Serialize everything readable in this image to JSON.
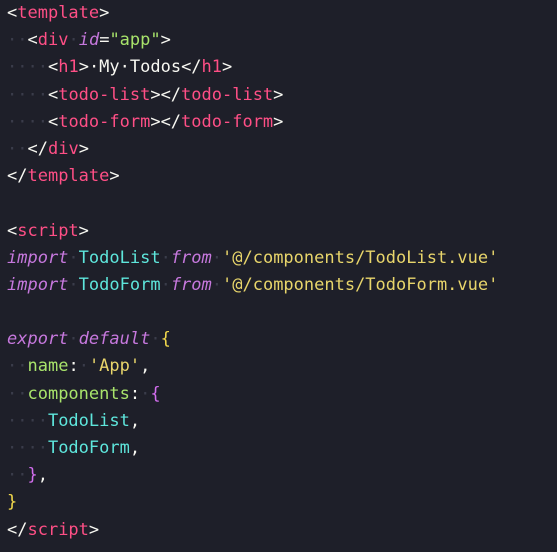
{
  "editor": {
    "lines": [
      [
        {
          "t": "<",
          "c": "t-punct"
        },
        {
          "t": "template",
          "c": "t-tag"
        },
        {
          "t": ">",
          "c": "t-punct"
        }
      ],
      [
        {
          "t": "··",
          "c": "ws"
        },
        {
          "t": "<",
          "c": "t-punct"
        },
        {
          "t": "div",
          "c": "t-tag"
        },
        {
          "t": "·",
          "c": "ws"
        },
        {
          "t": "id",
          "c": "t-attr"
        },
        {
          "t": "=",
          "c": "t-punct"
        },
        {
          "t": "\"app\"",
          "c": "t-str"
        },
        {
          "t": ">",
          "c": "t-punct"
        }
      ],
      [
        {
          "t": "····",
          "c": "ws"
        },
        {
          "t": "<",
          "c": "t-punct"
        },
        {
          "t": "h1",
          "c": "t-tag"
        },
        {
          "t": ">",
          "c": "t-punct"
        },
        {
          "t": "·My·Todos",
          "c": "t-text"
        },
        {
          "t": "</",
          "c": "t-punct"
        },
        {
          "t": "h1",
          "c": "t-tag"
        },
        {
          "t": ">",
          "c": "t-punct"
        }
      ],
      [
        {
          "t": "····",
          "c": "ws"
        },
        {
          "t": "<",
          "c": "t-punct"
        },
        {
          "t": "todo-list",
          "c": "t-tag"
        },
        {
          "t": "></",
          "c": "t-punct"
        },
        {
          "t": "todo-list",
          "c": "t-tag"
        },
        {
          "t": ">",
          "c": "t-punct"
        }
      ],
      [
        {
          "t": "····",
          "c": "ws"
        },
        {
          "t": "<",
          "c": "t-punct"
        },
        {
          "t": "todo-form",
          "c": "t-tag"
        },
        {
          "t": "></",
          "c": "t-punct"
        },
        {
          "t": "todo-form",
          "c": "t-tag"
        },
        {
          "t": ">",
          "c": "t-punct"
        }
      ],
      [
        {
          "t": "··",
          "c": "ws"
        },
        {
          "t": "</",
          "c": "t-punct"
        },
        {
          "t": "div",
          "c": "t-tag"
        },
        {
          "t": ">",
          "c": "t-punct"
        }
      ],
      [
        {
          "t": "</",
          "c": "t-punct"
        },
        {
          "t": "template",
          "c": "t-tag"
        },
        {
          "t": ">",
          "c": "t-punct"
        }
      ],
      [],
      [
        {
          "t": "<",
          "c": "t-punct"
        },
        {
          "t": "script",
          "c": "t-tag"
        },
        {
          "t": ">",
          "c": "t-punct"
        }
      ],
      [
        {
          "t": "import",
          "c": "t-kw"
        },
        {
          "t": "·",
          "c": "ws"
        },
        {
          "t": "TodoList",
          "c": "t-id"
        },
        {
          "t": "·",
          "c": "ws"
        },
        {
          "t": "from",
          "c": "t-kw"
        },
        {
          "t": "·",
          "c": "ws"
        },
        {
          "t": "'@/components/TodoList.vue'",
          "c": "t-modstr"
        }
      ],
      [
        {
          "t": "import",
          "c": "t-kw"
        },
        {
          "t": "·",
          "c": "ws"
        },
        {
          "t": "TodoForm",
          "c": "t-id"
        },
        {
          "t": "·",
          "c": "ws"
        },
        {
          "t": "from",
          "c": "t-kw"
        },
        {
          "t": "·",
          "c": "ws"
        },
        {
          "t": "'@/components/TodoForm.vue'",
          "c": "t-modstr"
        }
      ],
      [],
      [
        {
          "t": "export",
          "c": "t-kw"
        },
        {
          "t": "·",
          "c": "ws"
        },
        {
          "t": "default",
          "c": "t-kw"
        },
        {
          "t": "·",
          "c": "ws"
        },
        {
          "t": "{",
          "c": "t-brace"
        }
      ],
      [
        {
          "t": "··",
          "c": "ws"
        },
        {
          "t": "name",
          "c": "t-prop"
        },
        {
          "t": ":",
          "c": "t-punct"
        },
        {
          "t": "·",
          "c": "ws"
        },
        {
          "t": "'App'",
          "c": "t-modstr"
        },
        {
          "t": ",",
          "c": "t-punct"
        }
      ],
      [
        {
          "t": "··",
          "c": "ws"
        },
        {
          "t": "components",
          "c": "t-prop"
        },
        {
          "t": ":",
          "c": "t-punct"
        },
        {
          "t": "·",
          "c": "ws"
        },
        {
          "t": "{",
          "c": "t-brace2"
        }
      ],
      [
        {
          "t": "····",
          "c": "ws"
        },
        {
          "t": "TodoList",
          "c": "t-id"
        },
        {
          "t": ",",
          "c": "t-punct"
        }
      ],
      [
        {
          "t": "····",
          "c": "ws"
        },
        {
          "t": "TodoForm",
          "c": "t-id"
        },
        {
          "t": ",",
          "c": "t-punct"
        }
      ],
      [
        {
          "t": "··",
          "c": "ws"
        },
        {
          "t": "}",
          "c": "t-brace2"
        },
        {
          "t": ",",
          "c": "t-punct"
        }
      ],
      [
        {
          "t": "}",
          "c": "t-brace"
        }
      ],
      [
        {
          "t": "</",
          "c": "t-punct"
        },
        {
          "t": "script",
          "c": "t-tag"
        },
        {
          "t": ">",
          "c": "t-punct"
        }
      ]
    ]
  }
}
